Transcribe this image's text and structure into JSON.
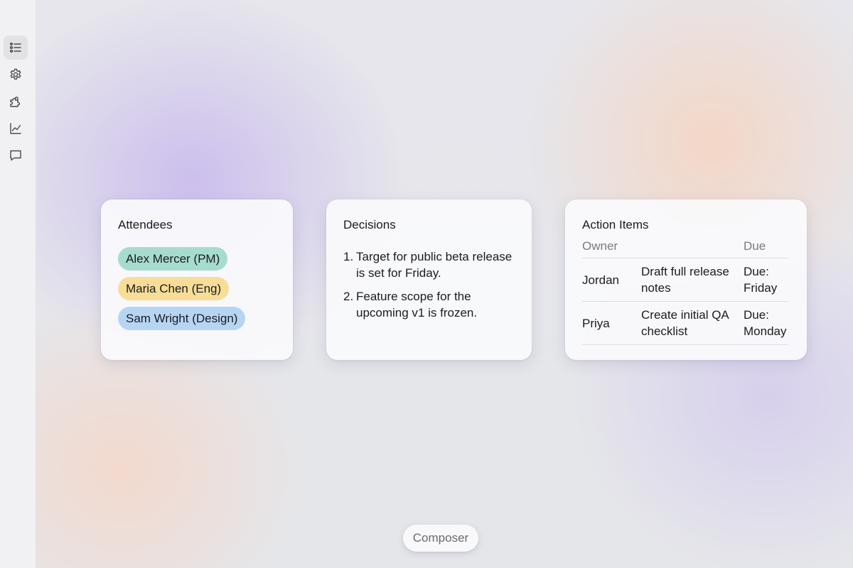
{
  "sidebar": {
    "items": [
      {
        "icon": "list-icon",
        "active": true
      },
      {
        "icon": "gear-icon",
        "active": false
      },
      {
        "icon": "puzzle-icon",
        "active": false
      },
      {
        "icon": "chart-icon",
        "active": false
      },
      {
        "icon": "chat-icon",
        "active": false
      }
    ]
  },
  "attendees": {
    "title": "Attendees",
    "people": [
      {
        "label": "Alex Mercer (PM)",
        "color": "#a6dccf"
      },
      {
        "label": "Maria Chen (Eng)",
        "color": "#f7dd97"
      },
      {
        "label": "Sam Wright (Design)",
        "color": "#b6d5f3"
      }
    ]
  },
  "decisions": {
    "title": "Decisions",
    "items": [
      {
        "num": "1.",
        "text": "Target for public beta release is set for Friday."
      },
      {
        "num": "2.",
        "text": "Feature scope for the upcoming v1 is frozen."
      }
    ]
  },
  "action_items": {
    "title": "Action Items",
    "headers": {
      "owner": "Owner",
      "task": "",
      "due": "Due"
    },
    "rows": [
      {
        "owner": "Jordan",
        "task": "Draft full release notes",
        "due": "Due: Friday"
      },
      {
        "owner": "Priya",
        "task": "Create initial QA checklist",
        "due": "Due: Monday"
      }
    ]
  },
  "composer": {
    "label": "Composer"
  }
}
